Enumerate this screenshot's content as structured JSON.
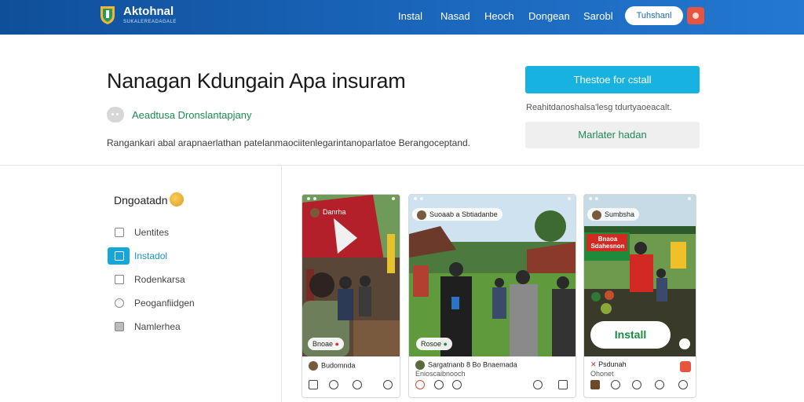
{
  "nav": {
    "brand": "Aktohnal",
    "brand_sub": "SUKALEREADAGALE",
    "links": [
      "Instal",
      "Nasad",
      "Heoch",
      "Dongean",
      "Sarobl"
    ],
    "button_label": "Tuhshanl",
    "accent": "#1b67bd",
    "notify_color": "#e5553f"
  },
  "hero": {
    "title": "Nanagan Kdungain Apa insuram",
    "tag": "Aeadtusa Dronslantapjany",
    "description": "Rangankari abal arapnaerlathan patelanmaociitenlegarintanoparlatoe Berangoceptand.",
    "primary_cta": "Thestoe for cstall",
    "note": "Reahitdanoshalsa'lesg tdurtyaoeacalt.",
    "secondary_cta": "Marlater hadan",
    "accent": "#17b2e0",
    "tag_color": "#1c8a54"
  },
  "sidebar": {
    "title": "Dngoatadn",
    "items": [
      {
        "label": "Uentites",
        "icon": "square-icon"
      },
      {
        "label": "Instadol",
        "icon": "install-icon"
      },
      {
        "label": "Rodenkarsa",
        "icon": "edit-icon"
      },
      {
        "label": "Peoganfiidgen",
        "icon": "settings-icon"
      },
      {
        "label": "Namlerhea",
        "icon": "box-icon"
      }
    ]
  },
  "cards": [
    {
      "header": "Danrha",
      "sign_text": "",
      "pill": "Bnoae",
      "footer_name": "Budomnda",
      "footer_line2": ""
    },
    {
      "header": "Suoaab a Sbtiadanbe",
      "sign_text": "",
      "pill": "Rosoe",
      "footer_name": "Sargatnanb 8 Bo Bnaemada",
      "footer_line2": "Enioscaibnooch"
    },
    {
      "header": "Sumbsha",
      "sign_text": "Bnaoa Sdahesnon",
      "install_label": "Install",
      "footer_name": "Psdunah",
      "footer_line2": "Ohonet"
    }
  ]
}
